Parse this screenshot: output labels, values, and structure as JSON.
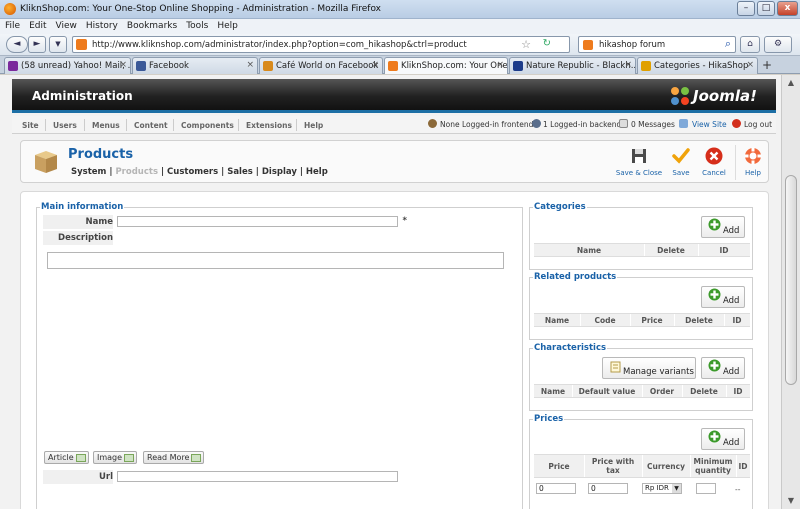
{
  "window": {
    "title": "KliknShop.com: Your One-Stop Online Shopping - Administration - Mozilla Firefox",
    "minimize": "–",
    "maximize": "□",
    "close": "x"
  },
  "menu": [
    "File",
    "Edit",
    "View",
    "History",
    "Bookmarks",
    "Tools",
    "Help"
  ],
  "nav": {
    "back": "◄",
    "forward": "►",
    "url": "http://www.kliknshop.com/administrator/index.php?option=com_hikashop&ctrl=product",
    "search_value": "hikashop forum",
    "home": "⌂",
    "tools": "⚙"
  },
  "tabs": [
    {
      "label": "(58 unread) Yahoo! Mail, ...",
      "color": "#7b2a9c"
    },
    {
      "label": "Facebook",
      "color": "#3b5998"
    },
    {
      "label": "Café World on Facebook",
      "color": "#d88a1c"
    },
    {
      "label": "KliknShop.com: Your One...",
      "color": "#ee7b1d"
    },
    {
      "label": "Nature Republic - Blackh...",
      "color": "#1d3c8a"
    },
    {
      "label": "Categories - HikaShop",
      "color": "#e0a000"
    }
  ],
  "new_tab": "+",
  "admin": {
    "title": "Administration",
    "logo_text": "Joomla!"
  },
  "submenu": {
    "items": [
      "Site",
      "Users",
      "Menus",
      "Content",
      "Components",
      "Extensions",
      "Help"
    ],
    "status": {
      "frontend": "None Logged-in frontend",
      "backend": "1 Logged-in backend",
      "messages": "0 Messages",
      "view_site": "View Site",
      "logout": "Log out"
    }
  },
  "toolbar": {
    "title": "Products",
    "crumbs": [
      "System",
      "Products",
      "Customers",
      "Sales",
      "Display",
      "Help"
    ],
    "buttons": {
      "save_close": "Save & Close",
      "save": "Save",
      "cancel": "Cancel",
      "help": "Help"
    }
  },
  "main_info": {
    "legend": "Main information",
    "name_label": "Name",
    "required": "*",
    "description_label": "Description",
    "article_btn": "Article",
    "image_btn": "Image",
    "readmore_btn": "Read More",
    "url_label": "Url"
  },
  "categories": {
    "legend": "Categories",
    "add": "Add",
    "columns": [
      "Name",
      "Delete",
      "ID"
    ]
  },
  "related": {
    "legend": "Related products",
    "add": "Add",
    "columns": [
      "Name",
      "Code",
      "Price",
      "Delete",
      "ID"
    ]
  },
  "characteristics": {
    "legend": "Characteristics",
    "manage": "Manage variants",
    "add": "Add",
    "columns": [
      "Name",
      "Default value",
      "Order",
      "Delete",
      "ID"
    ]
  },
  "prices": {
    "legend": "Prices",
    "add": "Add",
    "columns": [
      "Price",
      "Price with tax",
      "Currency",
      "Minimum quantity",
      "ID"
    ],
    "row": {
      "price": "0",
      "price_tax": "0",
      "currency": "Rp IDR",
      "id": "--"
    }
  }
}
